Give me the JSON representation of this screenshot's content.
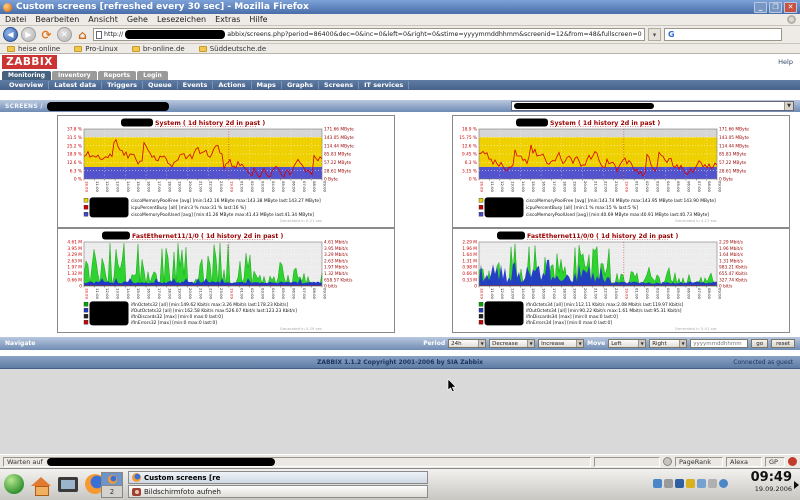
{
  "window": {
    "title": "Custom screens [refreshed every 30 sec] - Mozilla Firefox"
  },
  "menu": {
    "items": [
      "Datei",
      "Bearbeiten",
      "Ansicht",
      "Gehe",
      "Lesezeichen",
      "Extras",
      "Hilfe"
    ]
  },
  "toolbar": {
    "url_scheme": "http://",
    "url_visible": "abbix/screens.php?period=86400&dec=0&inc=0&left=0&right=0&stime=yyyymmddhhmm&screenid=12&from=48&fullscreen=0",
    "search_logo": "G"
  },
  "bookmarks": {
    "items": [
      "heise online",
      "Pro-Linux",
      "br-online.de",
      "Süddeutsche.de"
    ]
  },
  "zabbix": {
    "logo": "ZABBIX",
    "help_link": "Help",
    "tabs": [
      {
        "label": "Monitoring",
        "active": true
      },
      {
        "label": "Inventory",
        "active": false
      },
      {
        "label": "Reports",
        "active": false
      },
      {
        "label": "Login",
        "active": false
      }
    ],
    "nav_links": [
      "Overview",
      "Latest data",
      "Triggers",
      "Queue",
      "Events",
      "Actions",
      "Maps",
      "Graphs",
      "Screens",
      "IT services"
    ],
    "screens_label": "SCREENS /",
    "navigate_label": "Navigate",
    "period_label": "Period",
    "period_value": "24h",
    "decrease_value": "Decrease",
    "increase_value": "Increase",
    "move_label": "Move",
    "move_left_value": "Left",
    "move_right_value": "Right",
    "stime_value": "yyyymmddhhmm",
    "go_button": "go",
    "reset_button": "reset",
    "footer_copyright": "ZABBIX 1.1.2 Copyright 2001-2006 by SIA Zabbix",
    "footer_connected": "Connected as guest"
  },
  "graphs_common": {
    "x_times": [
      "10:00",
      "11:00",
      "12:00",
      "13:00",
      "14:00",
      "15:00",
      "16:00",
      "17:00",
      "18:00",
      "19:00",
      "20:00",
      "21:00",
      "22:00",
      "23:00",
      "00:00",
      "01:00",
      "02:00",
      "03:00",
      "04:00",
      "05:00",
      "06:00",
      "07:00",
      "08:00",
      "09:00"
    ],
    "x_dates": [
      "18.09",
      "19.09"
    ],
    "date_tick_indexes": [
      0,
      14
    ]
  },
  "graphs": [
    {
      "kind": "memory",
      "title": "System ( 1d history 2d in past )",
      "left_axis": [
        "37.8 %",
        "31.5 %",
        "25.2 %",
        "18.9 %",
        "12.6 %",
        "6.3 %",
        "0 %"
      ],
      "right_axis": [
        "171.66 MByte",
        "143.05 MByte",
        "114.44 MByte",
        "85.83 MByte",
        "57.22 MByte",
        "28.61 MByte",
        "0 Byte"
      ],
      "legend": [
        {
          "color": "#e6d300",
          "text": "ciscoMemoryPoolFree [avg] [min:142.16 MByte max:143.38 MByte last:143.27 MByte]"
        },
        {
          "color": "#cc0000",
          "text": "icpuPercentBusy    [all] [min:3 % max:31 % last:16 %]"
        },
        {
          "color": "#4646c8",
          "text": "ciscoMemoryPoolUsed [avg] [min:41.26 MByte max:41.43 MByte last:41.34 MByte]"
        }
      ],
      "generated": "Generated in 0.21 sec"
    },
    {
      "kind": "memory",
      "title": "System ( 1d history 2d in past )",
      "left_axis": [
        "18.9 %",
        "15.75 %",
        "12.6 %",
        "9.45 %",
        "6.3 %",
        "3.15 %",
        "0 %"
      ],
      "right_axis": [
        "171.66 MByte",
        "143.05 MByte",
        "114.44 MByte",
        "85.83 MByte",
        "57.22 MByte",
        "28.61 MByte",
        "0 Byte"
      ],
      "legend": [
        {
          "color": "#e6d300",
          "text": "ciscoMemoryPoolFree [avg] [min:143.74 MByte max:143.95 MByte last:143.90 MByte]"
        },
        {
          "color": "#cc0000",
          "text": "icpuPercentBusy    [all] [min:1 % max:15 % last:5 %]"
        },
        {
          "color": "#4646c8",
          "text": "ciscoMemoryPoolUsed [avg] [min:40.69 MByte max:40.91 MByte last:40.73 MByte]"
        }
      ],
      "generated": "Generated in 4.27 sec"
    },
    {
      "kind": "traffic",
      "title": "FastEthernet11/1/0 ( 1d history 2d in past )",
      "left_axis": [
        "4.61 M",
        "3.95 M",
        "3.29 M",
        "2.63 M",
        "1.97 M",
        "1.32 M",
        "0.66 M",
        "0"
      ],
      "right_axis": [
        "4.61 Mbit/s",
        "3.95 Mbit/s",
        "3.29 Mbit/s",
        "2.63 Mbit/s",
        "1.97 Mbit/s",
        "1.32 Mbit/s",
        "658.57 Kbit/s",
        "0 bit/s"
      ],
      "legend": [
        {
          "color": "#00a800",
          "text": "ifInOctets32   [all] [min:149.62 Kbit/s max:3.26 Mbit/s last:178.23 Kbit/s]"
        },
        {
          "color": "#2038c0",
          "text": "ifOutOctets32  [all] [min:162.58 Kbit/s max:526.07 Kbit/s last:123.23 Kbit/s]"
        },
        {
          "color": "#222222",
          "text": "ifInDiscards32 [max] [min:0 max:0 last:0]"
        },
        {
          "color": "#cc0000",
          "text": "ifInErrors32   [max] [min:0 max:0 last:0]"
        }
      ],
      "generated": "Generated in 5.29 sec"
    },
    {
      "kind": "traffic",
      "title": "FastEthernet11/0/0 ( 1d history 2d in past )",
      "left_axis": [
        "2.29 M",
        "1.96 M",
        "1.64 M",
        "1.31 M",
        "0.98 M",
        "0.66 M",
        "0.33 M",
        "0"
      ],
      "right_axis": [
        "2.29 Mbit/s",
        "1.96 Mbit/s",
        "1.64 Mbit/s",
        "1.31 Mbit/s",
        "983.21 Kbit/s",
        "655.47 Kbit/s",
        "327.74 Kbit/s",
        "0 bit/s"
      ],
      "legend": [
        {
          "color": "#00a800",
          "text": "ifInOctets34   [all] [min:112.11 Kbit/s max:2.08 Mbit/s last:119.97 Kbit/s]"
        },
        {
          "color": "#2038c0",
          "text": "ifOutOctets34  [all] [min:90.22 Kbit/s max:1.61 Mbit/s last:95.31 Kbit/s]"
        },
        {
          "color": "#222222",
          "text": "ifInDiscards34 [max] [min:0 max:0 last:0]"
        },
        {
          "color": "#cc0000",
          "text": "ifInErrors34   [max] [min:0 max:0 last:0]"
        }
      ],
      "generated": "Generated in 5.41 sec"
    }
  ],
  "statusbar": {
    "loading_text": "Warten auf",
    "widgets": [
      "PageRank",
      "Alexa",
      "GP"
    ]
  },
  "taskbar": {
    "workspace_number": "2",
    "tasks": [
      {
        "title": "Custom screens [re",
        "active": true
      },
      {
        "title": "Bildschirmfoto aufneh",
        "active": false
      }
    ],
    "clock": "09:49",
    "date": "19.09.2006"
  }
}
